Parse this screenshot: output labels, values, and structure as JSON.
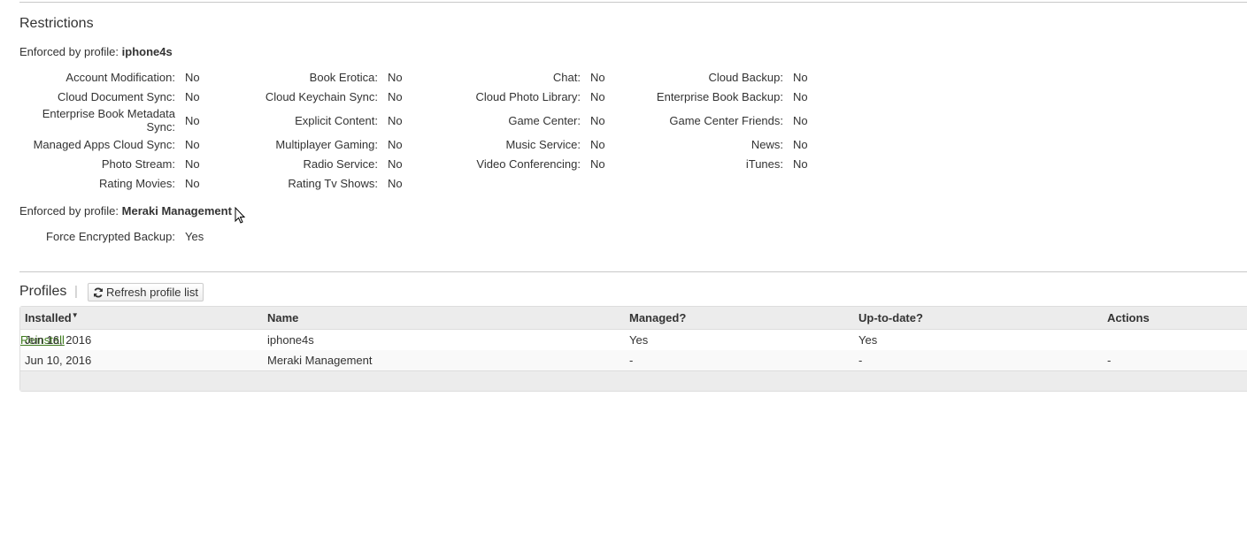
{
  "restrictions": {
    "title": "Restrictions",
    "groups": [
      {
        "enforced_prefix": "Enforced by profile:",
        "profile": "iphone4s",
        "rows": [
          [
            [
              "Account Modification:",
              "No"
            ],
            [
              "Book Erotica:",
              "No"
            ],
            [
              "Chat:",
              "No"
            ],
            [
              "Cloud Backup:",
              "No"
            ]
          ],
          [
            [
              "Cloud Document Sync:",
              "No"
            ],
            [
              "Cloud Keychain Sync:",
              "No"
            ],
            [
              "Cloud Photo Library:",
              "No"
            ],
            [
              "Enterprise Book Backup:",
              "No"
            ]
          ],
          [
            [
              "Enterprise Book Metadata Sync:",
              "No"
            ],
            [
              "Explicit Content:",
              "No"
            ],
            [
              "Game Center:",
              "No"
            ],
            [
              "Game Center Friends:",
              "No"
            ]
          ],
          [
            [
              "Managed Apps Cloud Sync:",
              "No"
            ],
            [
              "Multiplayer Gaming:",
              "No"
            ],
            [
              "Music Service:",
              "No"
            ],
            [
              "News:",
              "No"
            ]
          ],
          [
            [
              "Photo Stream:",
              "No"
            ],
            [
              "Radio Service:",
              "No"
            ],
            [
              "Video Conferencing:",
              "No"
            ],
            [
              "iTunes:",
              "No"
            ]
          ],
          [
            [
              "Rating Movies:",
              "No"
            ],
            [
              "Rating Tv Shows:",
              "No"
            ]
          ]
        ]
      },
      {
        "enforced_prefix": "Enforced by profile:",
        "profile": "Meraki Management",
        "rows": [
          [
            [
              "Force Encrypted Backup:",
              "Yes"
            ]
          ]
        ]
      }
    ]
  },
  "profiles": {
    "title": "Profiles",
    "refresh_label": "Refresh profile list",
    "refresh_icon": "refresh-icon",
    "columns": [
      "Installed",
      "Name",
      "Managed?",
      "Up-to-date?",
      "Actions"
    ],
    "sort_indicator": "▼",
    "rows": [
      {
        "installed": "Jun 16, 2016",
        "name": "iphone4s",
        "managed": "Yes",
        "uptodate": "Yes",
        "action": "Reinstall"
      },
      {
        "installed": "Jun 10, 2016",
        "name": "Meraki Management",
        "managed": "-",
        "uptodate": "-",
        "action": "-"
      }
    ]
  }
}
